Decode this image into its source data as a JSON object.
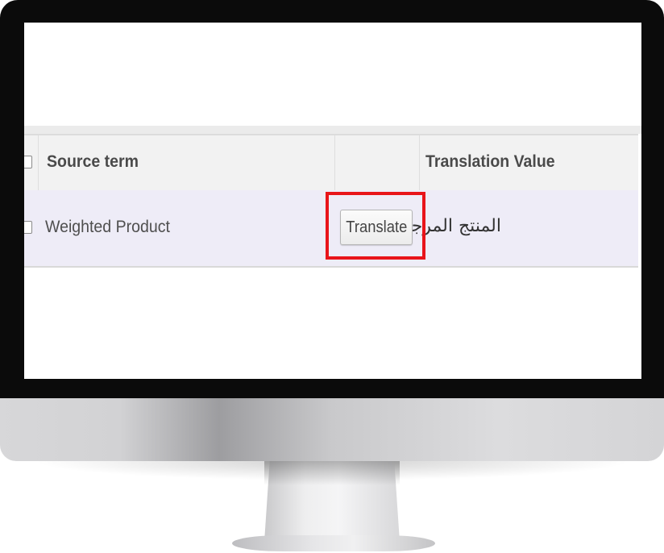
{
  "table": {
    "headers": {
      "source_term": "Source term",
      "action": "",
      "translation_value": "Translation Value"
    },
    "rows": [
      {
        "source_term": "Weighted Product",
        "button_label": "Translate",
        "translation_value": "المنتج المرجح"
      }
    ]
  },
  "colors": {
    "row_highlight": "#eeecf7",
    "annotation_box": "#e8141a",
    "header_bg": "#f2f2f2"
  },
  "icons": {
    "checkbox": "checkbox-square"
  }
}
